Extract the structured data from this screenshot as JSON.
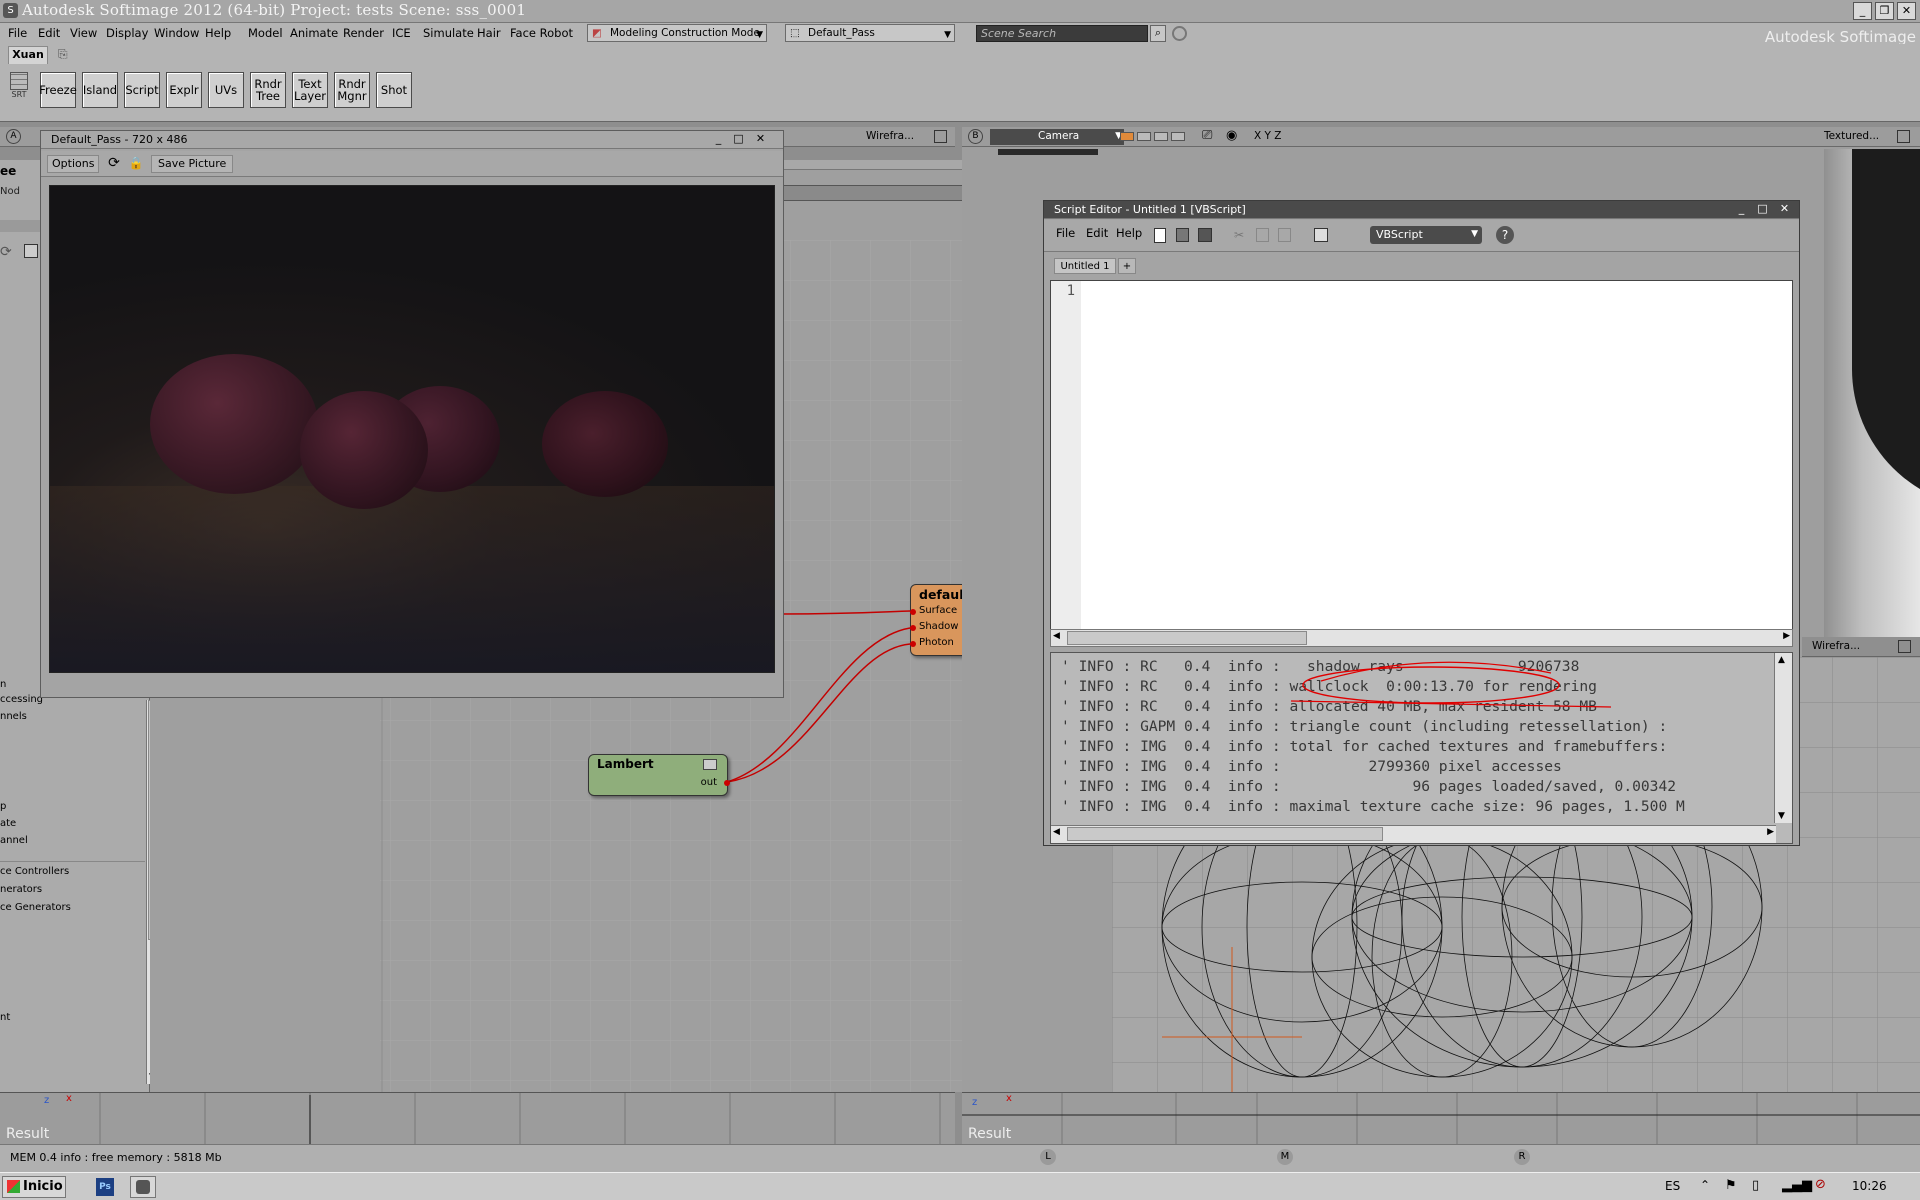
{
  "app": {
    "title": "Autodesk Softimage 2012 (64-bit)    Project: tests    Scene: sss_0001",
    "brand": "Autodesk Softimage"
  },
  "menu": [
    "File",
    "Edit",
    "View",
    "Display",
    "Window",
    "Help",
    "Model",
    "Animate",
    "Render",
    "ICE",
    "Simulate",
    "Hair",
    "Face Robot"
  ],
  "mode": {
    "label": "Modeling Construction Mode"
  },
  "pass": {
    "label": "Default_Pass"
  },
  "search": {
    "placeholder": "Scene Search"
  },
  "shelf": {
    "tab": "Xuan",
    "srt_label": "SRT",
    "buttons": [
      "Freeze",
      "Island",
      "Script",
      "Explr",
      "UVs",
      "Rndr Tree",
      "Text Layer",
      "Rndr Mgnr",
      "Shot"
    ]
  },
  "viewport_a": {
    "letter": "A",
    "mode": "Wirefra..."
  },
  "viewport_b": {
    "letter": "B",
    "camera": "Camera",
    "axes": "X Y Z",
    "mode": "Textured..."
  },
  "viewport_d": {
    "mode": "Wirefra..."
  },
  "render_window": {
    "title": "Default_Pass - 720 x 486",
    "options": "Options",
    "save": "Save Picture"
  },
  "render_tree": {
    "nodes": {
      "lambert_main": {
        "title": "defaultLambert",
        "ports": [
          "Surface",
          "Shadow",
          "Photon"
        ]
      },
      "lambert_src": {
        "title": "Lambert",
        "out": "out"
      }
    }
  },
  "explorer": {
    "title": "ee",
    "tab": "Nod",
    "items": [
      "n",
      "ccessing",
      "nnels",
      "p",
      "ate",
      "annel",
      "ce Controllers",
      "nerators",
      "ce Generators",
      "nt"
    ]
  },
  "script_editor": {
    "title": "Script Editor - Untitled 1  [VBScript]",
    "menu": [
      "File",
      "Edit",
      "Help"
    ],
    "language": "VBScript",
    "tab": "Untitled 1",
    "add_tab": "+",
    "line_no": "1",
    "log": [
      "' INFO : RC   0.4  info :   shadow rays             9206738",
      "' INFO : RC   0.4  info : wallclock  0:00:13.70 for rendering",
      "' INFO : RC   0.4  info : allocated 40 MB, max resident 58 MB",
      "' INFO : GAPM 0.4  info : triangle count (including retessellation) :",
      "' INFO : IMG  0.4  info : total for cached textures and framebuffers:",
      "' INFO : IMG  0.4  info :          2799360 pixel accesses",
      "' INFO : IMG  0.4  info :               96 pages loaded/saved, 0.00342",
      "' INFO : IMG  0.4  info : maximal texture cache size: 96 pages, 1.500 M"
    ]
  },
  "result_left": "Result",
  "result_right": "Result",
  "timeline_marks": [
    "L",
    "M",
    "R"
  ],
  "status": {
    "text": "MEM  0.4  info : free memory : 5818 Mb"
  },
  "taskbar": {
    "start": "Inicio",
    "ps": "Ps",
    "lang": "ES",
    "clock": "10:26"
  },
  "colors": {
    "node_orange": "#d9965c",
    "node_green": "#8fae7b",
    "wire": "#c40000",
    "annotation": "#e00000"
  }
}
